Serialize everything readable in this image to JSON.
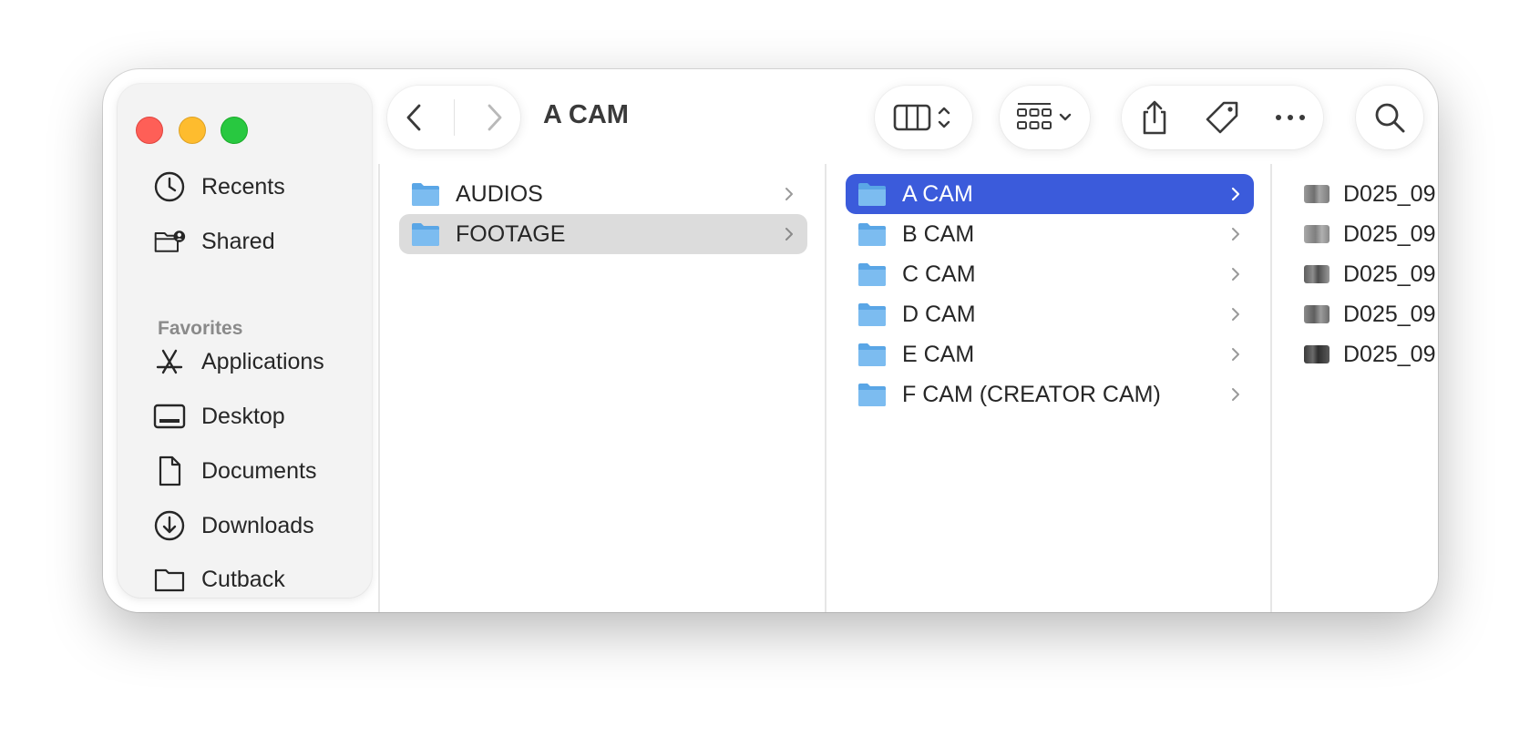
{
  "window": {
    "title": "A CAM"
  },
  "sidebar": {
    "top_items": [
      {
        "label": "Recents",
        "icon": "clock-icon"
      },
      {
        "label": "Shared",
        "icon": "shared-folder-icon"
      }
    ],
    "favorites_heading": "Favorites",
    "favorites": [
      {
        "label": "Applications",
        "icon": "applications-icon"
      },
      {
        "label": "Desktop",
        "icon": "desktop-icon"
      },
      {
        "label": "Documents",
        "icon": "document-icon"
      },
      {
        "label": "Downloads",
        "icon": "download-icon"
      },
      {
        "label": "Cutback",
        "icon": "folder-icon"
      }
    ]
  },
  "toolbar": {
    "back_icon": "chevron-left-icon",
    "forward_icon": "chevron-right-icon",
    "view_icon": "column-view-icon",
    "group_icon": "group-grid-icon",
    "share_icon": "share-icon",
    "tag_icon": "tag-icon",
    "more_icon": "ellipsis-icon",
    "search_icon": "search-icon"
  },
  "columns": {
    "col1": [
      {
        "label": "AUDIOS",
        "selected": false
      },
      {
        "label": "FOOTAGE",
        "selected": true
      }
    ],
    "col2": [
      {
        "label": "A CAM",
        "selected": true
      },
      {
        "label": "B CAM",
        "selected": false
      },
      {
        "label": "C CAM",
        "selected": false
      },
      {
        "label": "D CAM",
        "selected": false
      },
      {
        "label": "E CAM",
        "selected": false
      },
      {
        "label": "F CAM (CREATOR CAM)",
        "selected": false
      }
    ],
    "col3": [
      {
        "label": "D025_09"
      },
      {
        "label": "D025_09"
      },
      {
        "label": "D025_09"
      },
      {
        "label": "D025_09"
      },
      {
        "label": "D025_09"
      }
    ]
  },
  "colors": {
    "selection_blue": "#3b5bdb",
    "selection_gray": "#dcdcdc",
    "folder_blue": "#6cb2ee"
  }
}
